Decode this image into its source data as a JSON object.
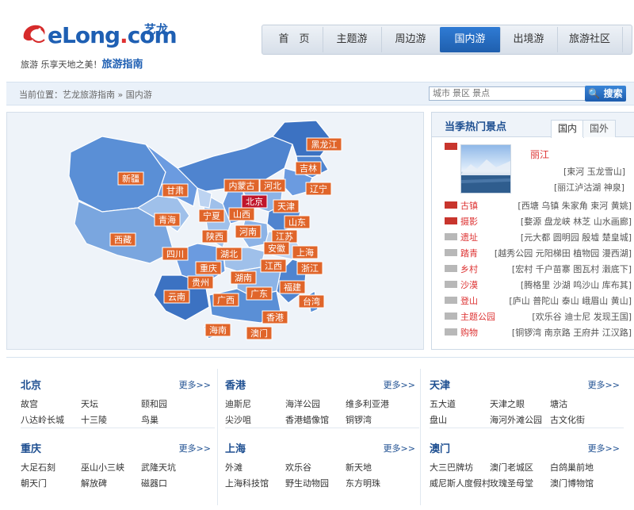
{
  "header": {
    "brand": "eLong",
    "brand_dot": ".",
    "brand_com": "com",
    "brand_cn": "艺龙",
    "slogan": "旅游 乐享天地之美！",
    "slogan_strong": "旅游指南"
  },
  "nav": {
    "tabs": [
      {
        "label": "首　页"
      },
      {
        "label": "主题游"
      },
      {
        "label": "周边游"
      },
      {
        "label": "国内游",
        "active": true
      },
      {
        "label": "出境游"
      },
      {
        "label": "旅游社区"
      }
    ]
  },
  "breadcrumb": {
    "text": "当前位置：艺龙旅游指南 » 国内游"
  },
  "search": {
    "placeholder": "城市 景区 景点",
    "button": "搜索"
  },
  "map": {
    "provinces": [
      {
        "label": "新疆"
      },
      {
        "label": "西藏"
      },
      {
        "label": "甘肃"
      },
      {
        "label": "青海"
      },
      {
        "label": "内蒙古"
      },
      {
        "label": "黑龙江"
      },
      {
        "label": "吉林"
      },
      {
        "label": "辽宁"
      },
      {
        "label": "北京",
        "highlight": true
      },
      {
        "label": "河北"
      },
      {
        "label": "天津"
      },
      {
        "label": "宁夏"
      },
      {
        "label": "山西"
      },
      {
        "label": "山东"
      },
      {
        "label": "陕西"
      },
      {
        "label": "河南"
      },
      {
        "label": "江苏"
      },
      {
        "label": "安徽"
      },
      {
        "label": "上海"
      },
      {
        "label": "四川"
      },
      {
        "label": "湖北"
      },
      {
        "label": "浙江"
      },
      {
        "label": "重庆"
      },
      {
        "label": "江西"
      },
      {
        "label": "贵州"
      },
      {
        "label": "湖南"
      },
      {
        "label": "福建"
      },
      {
        "label": "云南"
      },
      {
        "label": "广西"
      },
      {
        "label": "广东"
      },
      {
        "label": "台湾"
      },
      {
        "label": "香港"
      },
      {
        "label": "海南"
      },
      {
        "label": "澳门"
      }
    ]
  },
  "hot": {
    "title": "当季热门景点",
    "tabs": [
      "国内",
      "国外"
    ],
    "featured": {
      "name": "丽江",
      "tags": [
        "[束河 玉龙雪山]",
        "[丽江泸沽湖 神泉]"
      ]
    },
    "rows": [
      {
        "category": "古镇",
        "places": "[西塘 乌镇 朱家角 束河 黄姚]",
        "badge": "red"
      },
      {
        "category": "摄影",
        "places": "[婺源 盘龙峡 林芝 山水画廊]",
        "badge": "red"
      },
      {
        "category": "遗址",
        "places": "[元大都 圆明园 殷墟 楚皇城]",
        "badge": "gray"
      },
      {
        "category": "踏青",
        "places": "[越秀公园 元阳梯田 植物园 漫西湖]",
        "badge": "gray"
      },
      {
        "category": "乡村",
        "places": "[宏村 千户苗寨 图瓦村 瀔底下]",
        "badge": "gray"
      },
      {
        "category": "沙漠",
        "places": "[腾格里 沙湖 鸣沙山 库布其]",
        "badge": "gray"
      },
      {
        "category": "登山",
        "places": "[庐山 普陀山 泰山 峨眉山 黄山]",
        "badge": "gray"
      },
      {
        "category": "主题公园",
        "places": "[欢乐谷 迪士尼 发现王国]",
        "badge": "gray"
      },
      {
        "category": "购物",
        "places": "[铜锣湾 南京路 王府井 江汉路]",
        "badge": "gray"
      }
    ]
  },
  "more_label": "更多>>",
  "cities": [
    {
      "name": "北京",
      "items": [
        "故宫",
        "天坛",
        "颐和园",
        "八达岭长城",
        "十三陵",
        "鸟巢"
      ]
    },
    {
      "name": "香港",
      "items": [
        "迪斯尼",
        "海洋公园",
        "维多利亚港",
        "尖沙咀",
        "香港蜡像馆",
        "铜锣湾"
      ]
    },
    {
      "name": "天津",
      "items": [
        "五大道",
        "天津之眼",
        "塘沽",
        "盘山",
        "海河外滩公园",
        "古文化街"
      ]
    },
    {
      "name": "重庆",
      "items": [
        "大足石刻",
        "巫山小三峡",
        "武隆天坑",
        "朝天门",
        "解放碑",
        "磁器口"
      ]
    },
    {
      "name": "上海",
      "items": [
        "外滩",
        "欢乐谷",
        "新天地",
        "上海科技馆",
        "野生动物园",
        "东方明珠"
      ]
    },
    {
      "name": "澳门",
      "items": [
        "大三巴牌坊",
        "澳门老城区",
        "白鸽巢前地",
        "威尼斯人度假村",
        "玫瑰圣母堂",
        "澳门博物馆"
      ]
    }
  ]
}
